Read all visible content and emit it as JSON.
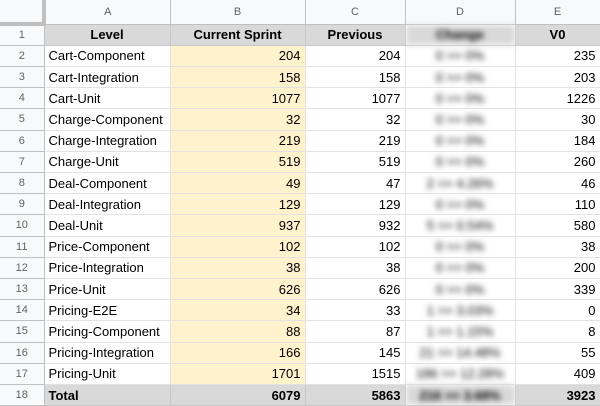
{
  "columns": [
    "A",
    "B",
    "C",
    "D",
    "E"
  ],
  "headers": [
    "Level",
    "Current Sprint",
    "Previous",
    "Change",
    "V0"
  ],
  "rows": [
    {
      "num": "2",
      "level": "Cart-Component",
      "current": "204",
      "previous": "204",
      "change": "0 >> 0%",
      "v0": "235"
    },
    {
      "num": "3",
      "level": "Cart-Integration",
      "current": "158",
      "previous": "158",
      "change": "0 >> 0%",
      "v0": "203"
    },
    {
      "num": "4",
      "level": "Cart-Unit",
      "current": "1077",
      "previous": "1077",
      "change": "0 >> 0%",
      "v0": "1226"
    },
    {
      "num": "5",
      "level": "Charge-Component",
      "current": "32",
      "previous": "32",
      "change": "0 >> 0%",
      "v0": "30"
    },
    {
      "num": "6",
      "level": "Charge-Integration",
      "current": "219",
      "previous": "219",
      "change": "0 >> 0%",
      "v0": "184"
    },
    {
      "num": "7",
      "level": "Charge-Unit",
      "current": "519",
      "previous": "519",
      "change": "0 >> 0%",
      "v0": "260"
    },
    {
      "num": "8",
      "level": "Deal-Component",
      "current": "49",
      "previous": "47",
      "change": "2 >> 4.26%",
      "v0": "46"
    },
    {
      "num": "9",
      "level": "Deal-Integration",
      "current": "129",
      "previous": "129",
      "change": "0 >> 0%",
      "v0": "110"
    },
    {
      "num": "10",
      "level": "Deal-Unit",
      "current": "937",
      "previous": "932",
      "change": "5 >> 0.54%",
      "v0": "580"
    },
    {
      "num": "11",
      "level": "Price-Component",
      "current": "102",
      "previous": "102",
      "change": "0 >> 0%",
      "v0": "38"
    },
    {
      "num": "12",
      "level": "Price-Integration",
      "current": "38",
      "previous": "38",
      "change": "0 >> 0%",
      "v0": "200"
    },
    {
      "num": "13",
      "level": "Price-Unit",
      "current": "626",
      "previous": "626",
      "change": "0 >> 0%",
      "v0": "339"
    },
    {
      "num": "14",
      "level": "Pricing-E2E",
      "current": "34",
      "previous": "33",
      "change": "1 >> 3.03%",
      "v0": "0"
    },
    {
      "num": "15",
      "level": "Pricing-Component",
      "current": "88",
      "previous": "87",
      "change": "1 >> 1.15%",
      "v0": "8"
    },
    {
      "num": "16",
      "level": "Pricing-Integration",
      "current": "166",
      "previous": "145",
      "change": "21 >> 14.48%",
      "v0": "55"
    },
    {
      "num": "17",
      "level": "Pricing-Unit",
      "current": "1701",
      "previous": "1515",
      "change": "186 >> 12.28%",
      "v0": "409"
    }
  ],
  "header_row_num": "1",
  "total": {
    "num": "18",
    "level": "Total",
    "current": "6079",
    "previous": "5863",
    "change": "216 >> 3.68%",
    "v0": "3923"
  },
  "colors": {
    "highlight": "#fff2cc",
    "header_bg": "#d9d9d9",
    "grid": "#e2e2e2"
  }
}
